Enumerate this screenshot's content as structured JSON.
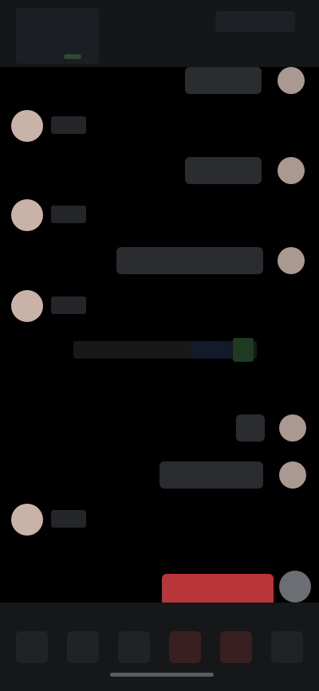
{
  "header": {
    "title": "",
    "subtitle": "",
    "right_label": ""
  },
  "messages": [
    {
      "kind": "out",
      "text": ""
    },
    {
      "kind": "in",
      "name": ""
    },
    {
      "kind": "out",
      "text": ""
    },
    {
      "kind": "in",
      "name": ""
    },
    {
      "kind": "out",
      "text": ""
    },
    {
      "kind": "in",
      "name": ""
    },
    {
      "kind": "link",
      "text": ""
    },
    {
      "kind": "caption",
      "text": ""
    },
    {
      "kind": "out",
      "text": ""
    },
    {
      "kind": "out",
      "text": ""
    },
    {
      "kind": "in",
      "name": ""
    },
    {
      "kind": "caption",
      "text": ""
    }
  ],
  "composer": {
    "send_label": ""
  },
  "nav": {
    "items": [
      "",
      "",
      "",
      "",
      "",
      ""
    ]
  },
  "colors": {
    "background": "#000000",
    "header": "#141618",
    "bubble": "#2a2c2f",
    "accent_red": "#b8363a",
    "avatar": "#c9b3a8",
    "link_blue": "#121a2c",
    "link_green": "#1e3a20"
  },
  "icons": {
    "user": "user-icon",
    "avatar": "avatar",
    "side_action": "circle-button-icon"
  }
}
